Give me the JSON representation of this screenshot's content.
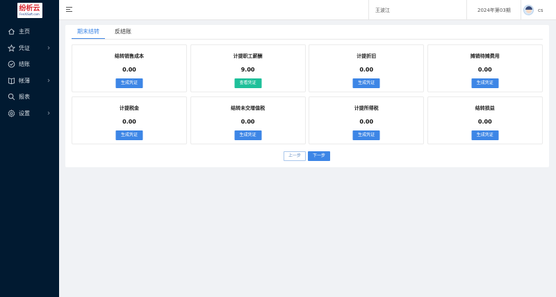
{
  "app": {
    "logo_name": "纷析云",
    "logo_sub": "FenXiSoft.com"
  },
  "sidebar": {
    "items": [
      {
        "label": "主页",
        "icon": "home-icon",
        "has_children": false
      },
      {
        "label": "凭证",
        "icon": "star-icon",
        "has_children": true
      },
      {
        "label": "结账",
        "icon": "check-circle-icon",
        "has_children": false
      },
      {
        "label": "帐薄",
        "icon": "books-icon",
        "has_children": true
      },
      {
        "label": "报表",
        "icon": "search-icon",
        "has_children": false
      },
      {
        "label": "设置",
        "icon": "gear-icon",
        "has_children": true
      }
    ]
  },
  "header": {
    "company": "王波江",
    "period": "2024年第03期",
    "username": "cs"
  },
  "tabs": [
    {
      "label": "期末结转",
      "active": true
    },
    {
      "label": "反结账",
      "active": false
    }
  ],
  "cards": [
    {
      "title": "结转销售成本",
      "value": "0.00",
      "button": "生成凭证",
      "button_color": "#3d86e6"
    },
    {
      "title": "计提职工薪酬",
      "value": "9.00",
      "button": "查看凭证",
      "button_color": "#1fc09a"
    },
    {
      "title": "计提折旧",
      "value": "0.00",
      "button": "生成凭证",
      "button_color": "#3d86e6"
    },
    {
      "title": "摊销待摊费用",
      "value": "0.00",
      "button": "生成凭证",
      "button_color": "#3d86e6"
    },
    {
      "title": "计提税金",
      "value": "0.00",
      "button": "生成凭证",
      "button_color": "#3d86e6"
    },
    {
      "title": "结转未交增值税",
      "value": "0.00",
      "button": "生成凭证",
      "button_color": "#3d86e6"
    },
    {
      "title": "计提所得税",
      "value": "0.00",
      "button": "生成凭证",
      "button_color": "#3d86e6"
    },
    {
      "title": "结转损益",
      "value": "0.00",
      "button": "生成凭证",
      "button_color": "#3d86e6"
    }
  ],
  "pager": {
    "prev": "上一步",
    "next": "下一步"
  },
  "colors": {
    "sidebar_bg": "#011a31",
    "accent": "#3d86e6",
    "success": "#1fc09a"
  }
}
